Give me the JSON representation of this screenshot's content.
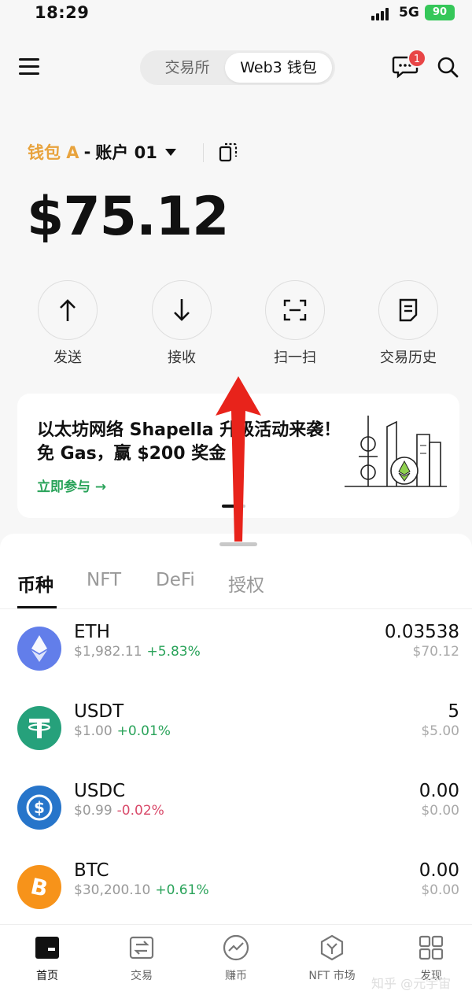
{
  "status_bar": {
    "time": "18:29",
    "network": "5G",
    "battery": "90"
  },
  "header": {
    "tabs": [
      {
        "label": "交易所"
      },
      {
        "label": "Web3 钱包"
      }
    ],
    "notification_count": "1"
  },
  "wallet": {
    "name": "钱包 A",
    "separator": "-",
    "account": "账户 01",
    "balance": "$75.12"
  },
  "actions": [
    {
      "label": "发送",
      "icon": "arrow-up-icon"
    },
    {
      "label": "接收",
      "icon": "arrow-down-icon"
    },
    {
      "label": "扫一扫",
      "icon": "scan-icon"
    },
    {
      "label": "交易历史",
      "icon": "history-icon"
    }
  ],
  "banner": {
    "title": "以太坊网络 Shapella 升级活动来袭！免 Gas，赢 $200 奖金",
    "link": "立即参与 →"
  },
  "asset_tabs": [
    {
      "label": "币种"
    },
    {
      "label": "NFT"
    },
    {
      "label": "DeFi"
    },
    {
      "label": "授权"
    }
  ],
  "assets": [
    {
      "symbol": "ETH",
      "price": "$1,982.11",
      "change": "+5.83%",
      "amount": "0.03538",
      "value": "$70.12",
      "color": "#627eea"
    },
    {
      "symbol": "USDT",
      "price": "$1.00",
      "change": "+0.01%",
      "amount": "5",
      "value": "$5.00",
      "color": "#26a17b"
    },
    {
      "symbol": "USDC",
      "price": "$0.99",
      "change": "-0.02%",
      "amount": "0.00",
      "value": "$0.00",
      "color": "#2775ca"
    },
    {
      "symbol": "BTC",
      "price": "$30,200.10",
      "change": "+0.61%",
      "amount": "0.00",
      "value": "$0.00",
      "color": "#f7931a"
    }
  ],
  "bottom_nav": [
    {
      "label": "首页",
      "icon": "home-icon"
    },
    {
      "label": "交易",
      "icon": "trade-icon"
    },
    {
      "label": "赚币",
      "icon": "earn-icon"
    },
    {
      "label": "NFT 市场",
      "icon": "nft-market-icon"
    },
    {
      "label": "发现",
      "icon": "discover-icon"
    }
  ],
  "watermark": "知乎 @元宇宙",
  "colors": {
    "accent_orange": "#e8a33d",
    "up_green": "#2aa35a",
    "down_red": "#d94a6a",
    "annotation_red": "#e8231b"
  }
}
